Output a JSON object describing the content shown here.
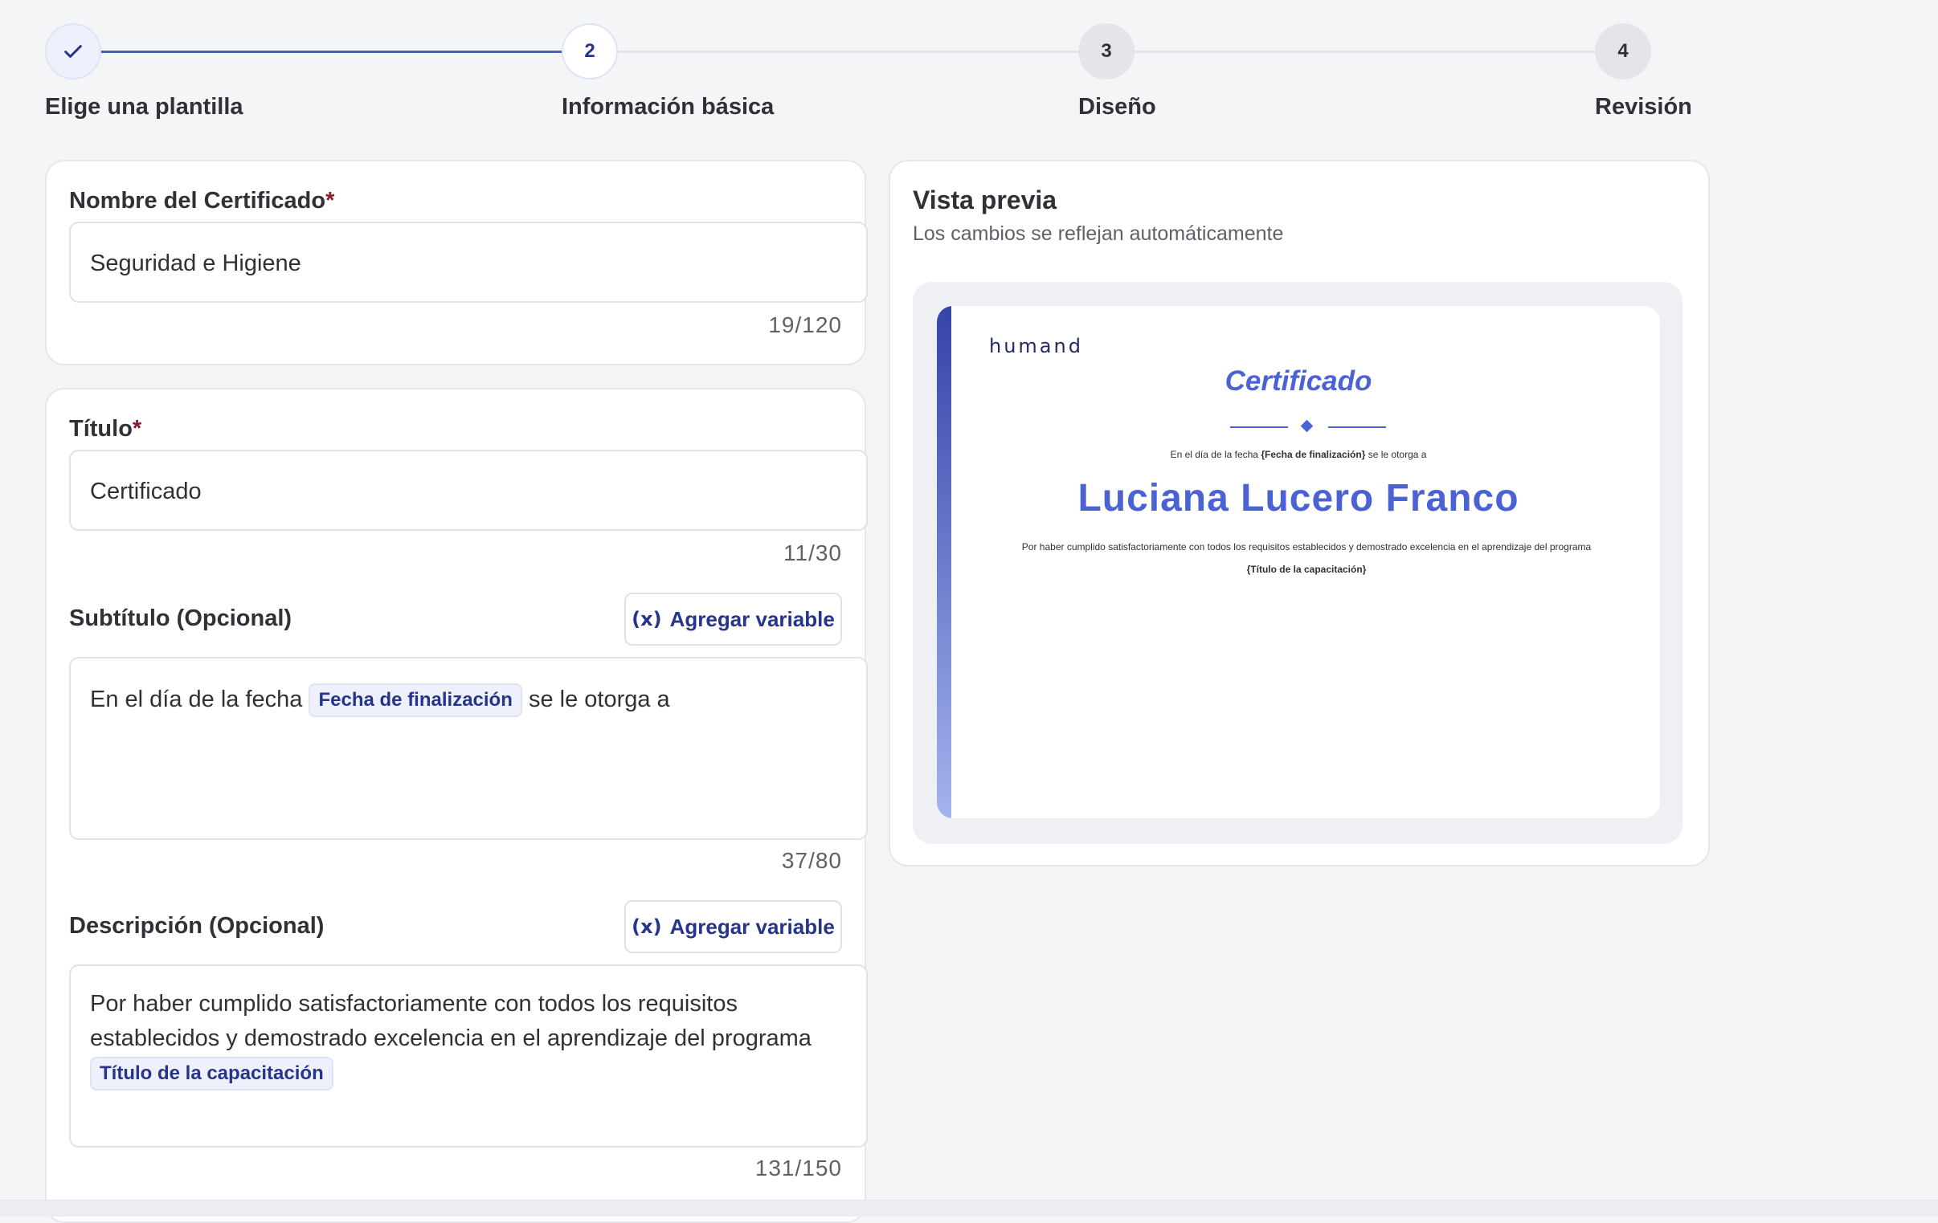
{
  "stepper": {
    "steps": [
      {
        "number": "",
        "label": "Elige una plantilla",
        "state": "done",
        "icon": "check-icon"
      },
      {
        "number": "2",
        "label": "Información básica",
        "state": "current"
      },
      {
        "number": "3",
        "label": "Diseño",
        "state": "todo"
      },
      {
        "number": "4",
        "label": "Revisión",
        "state": "todo"
      }
    ]
  },
  "form": {
    "certificate_name": {
      "label": "Nombre del Certificado",
      "required_mark": "*",
      "value": "Seguridad e Higiene",
      "counter": "19/120"
    },
    "title": {
      "label": "Título",
      "required_mark": "*",
      "value": "Certificado",
      "counter": "11/30"
    },
    "subtitle": {
      "label": "Subtítulo (Opcional)",
      "add_variable": "Agregar variable",
      "text_before": "En el día de la fecha",
      "variable": "Fecha de finalización",
      "text_after": "se le otorga a",
      "counter": "37/80"
    },
    "description": {
      "label": "Descripción (Opcional)",
      "add_variable": "Agregar variable",
      "text": "Por haber cumplido satisfactoriamente con todos los requisitos establecidos y demostrado excelencia en el aprendizaje del programa",
      "variable": "Título de la capacitación",
      "counter": "131/150"
    },
    "variable_icon": "(x)"
  },
  "preview": {
    "title": "Vista previa",
    "subtitle": "Los cambios se reflejan automáticamente",
    "certificate": {
      "logo": "humand",
      "title": "Certificado",
      "subtitle_before": "En el día de la fecha",
      "subtitle_variable": "{Fecha de finalización}",
      "subtitle_after": "se le otorga a",
      "recipient": "Luciana Lucero Franco",
      "description": "Por haber cumplido satisfactoriamente con todos los requisitos establecidos y demostrado excelencia en el aprendizaje del programa",
      "description_variable": "{Título de la capacitación}"
    }
  },
  "colors": {
    "accent": "#4a62d4",
    "chip_bg": "#eef0fb",
    "chip_text": "#27348b",
    "required": "#8b1a2b"
  }
}
